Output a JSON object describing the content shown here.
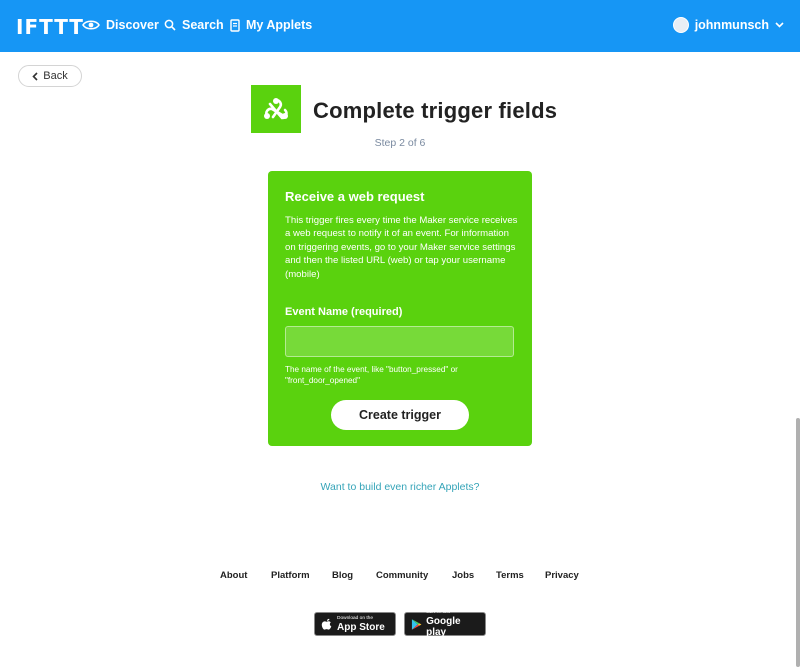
{
  "nav": {
    "logo": "IFTTT",
    "discover": "Discover",
    "search": "Search",
    "my_applets": "My Applets",
    "username": "johnmunsch"
  },
  "back": {
    "label": "Back"
  },
  "header": {
    "title": "Complete trigger fields",
    "step": "Step 2 of 6"
  },
  "trigger": {
    "title": "Receive a web request",
    "description": "This trigger fires every time the Maker service receives a web request to notify it of an event. For information on triggering events, go to your Maker service settings and then the listed URL (web) or tap your username (mobile)",
    "field_label": "Event Name (required)",
    "field_value": "",
    "field_help": "The name of the event, like \"button_pressed\" or \"front_door_opened\"",
    "button": "Create trigger"
  },
  "richer_link": "Want to build even richer Applets?",
  "footer": {
    "links": [
      "About",
      "Platform",
      "Blog",
      "Community",
      "Jobs",
      "Terms",
      "Privacy"
    ],
    "app_store": {
      "small": "Download on the",
      "big": "App Store"
    },
    "google_play": {
      "small": "GET IT ON",
      "big": "Google play"
    }
  },
  "colors": {
    "nav_bg": "#1696f5",
    "maker_green": "#5ad20e",
    "link_teal": "#35a4b8"
  }
}
